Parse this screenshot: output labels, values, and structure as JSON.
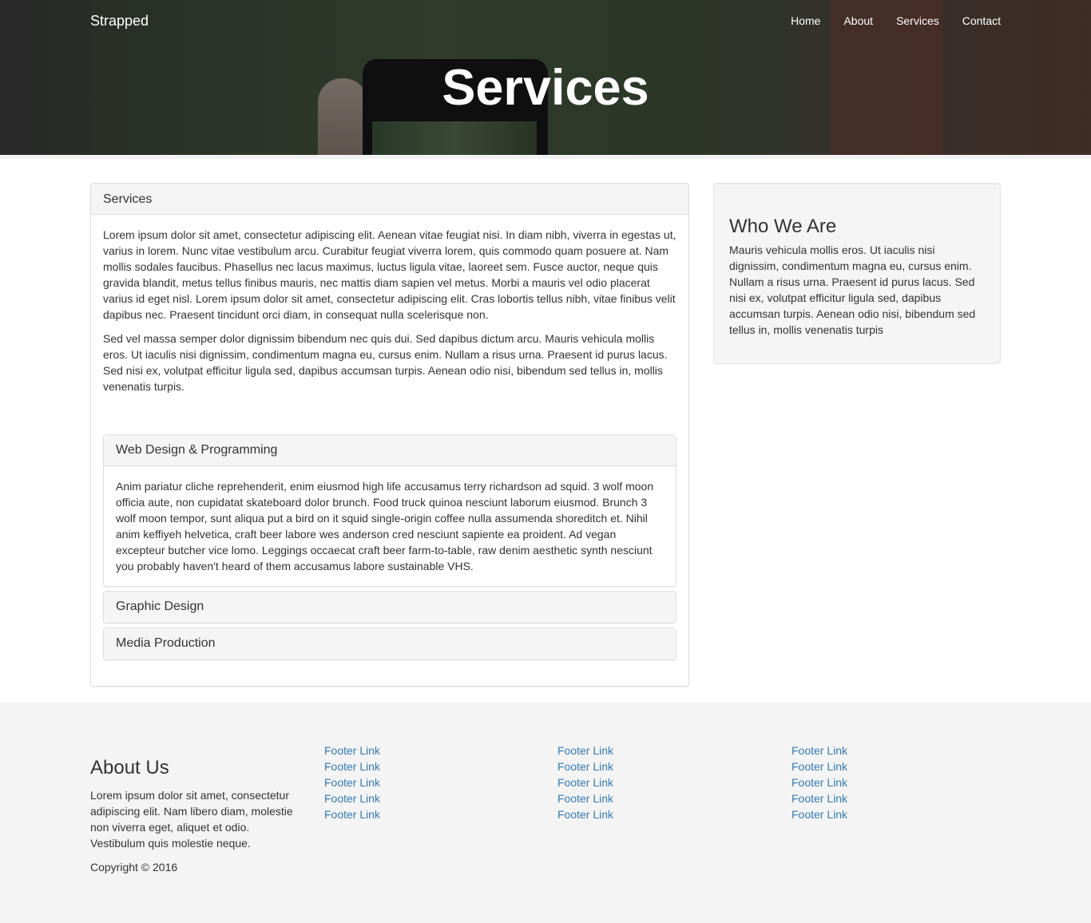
{
  "navbar": {
    "brand": "Strapped",
    "links": [
      "Home",
      "About",
      "Services",
      "Contact"
    ]
  },
  "hero": {
    "title": "Services"
  },
  "services_panel": {
    "heading": "Services",
    "paragraphs": [
      "Lorem ipsum dolor sit amet, consectetur adipiscing elit. Aenean vitae feugiat nisi. In diam nibh, viverra in egestas ut, varius in lorem. Nunc vitae vestibulum arcu. Curabitur feugiat viverra lorem, quis commodo quam posuere at. Nam mollis sodales faucibus. Phasellus nec lacus maximus, luctus ligula vitae, laoreet sem. Fusce auctor, neque quis gravida blandit, metus tellus finibus mauris, nec mattis diam sapien vel metus. Morbi a mauris vel odio placerat varius id eget nisl. Lorem ipsum dolor sit amet, consectetur adipiscing elit. Cras lobortis tellus nibh, vitae finibus velit dapibus nec. Praesent tincidunt orci diam, in consequat nulla scelerisque non.",
      "Sed vel massa semper dolor dignissim bibendum nec quis dui. Sed dapibus dictum arcu. Mauris vehicula mollis eros. Ut iaculis nisi dignissim, condimentum magna eu, cursus enim. Nullam a risus urna. Praesent id purus lacus. Sed nisi ex, volutpat efficitur ligula sed, dapibus accumsan turpis. Aenean odio nisi, bibendum sed tellus in, mollis venenatis turpis."
    ],
    "accordion": [
      {
        "title": "Web Design & Programming",
        "body": "Anim pariatur cliche reprehenderit, enim eiusmod high life accusamus terry richardson ad squid. 3 wolf moon officia aute, non cupidatat skateboard dolor brunch. Food truck quinoa nesciunt laborum eiusmod. Brunch 3 wolf moon tempor, sunt aliqua put a bird on it squid single-origin coffee nulla assumenda shoreditch et. Nihil anim keffiyeh helvetica, craft beer labore wes anderson cred nesciunt sapiente ea proident. Ad vegan excepteur butcher vice lomo. Leggings occaecat craft beer farm-to-table, raw denim aesthetic synth nesciunt you probably haven't heard of them accusamus labore sustainable VHS."
      },
      {
        "title": "Graphic Design"
      },
      {
        "title": "Media Production"
      }
    ]
  },
  "sidebar": {
    "title": "Who We Are",
    "text": "Mauris vehicula mollis eros. Ut iaculis nisi dignissim, condimentum magna eu, cursus enim. Nullam a risus urna. Praesent id purus lacus. Sed nisi ex, volutpat efficitur ligula sed, dapibus accumsan turpis. Aenean odio nisi, bibendum sed tellus in, mollis venenatis turpis"
  },
  "footer": {
    "about_title": "About Us",
    "about_text": "Lorem ipsum dolor sit amet, consectetur adipiscing elit. Nam libero diam, molestie non viverra eget, aliquet et odio. Vestibulum quis molestie neque.",
    "copyright": "Copyright © 2016",
    "link_columns": [
      [
        "Footer Link",
        "Footer Link",
        "Footer Link",
        "Footer Link",
        "Footer Link"
      ],
      [
        "Footer Link",
        "Footer Link",
        "Footer Link",
        "Footer Link",
        "Footer Link"
      ],
      [
        "Footer Link",
        "Footer Link",
        "Footer Link",
        "Footer Link",
        "Footer Link"
      ]
    ],
    "link_color": "#337ab7"
  }
}
